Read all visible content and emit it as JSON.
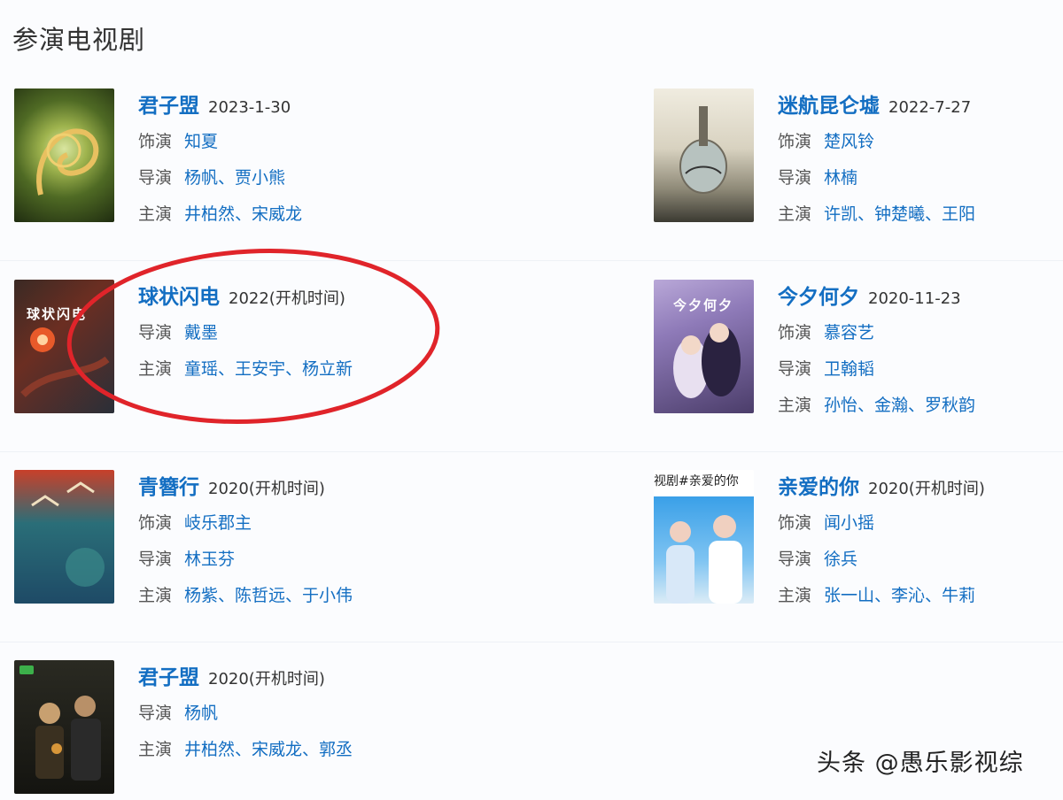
{
  "section": {
    "title": "参演电视剧"
  },
  "labels": {
    "role": "饰演",
    "director": "导演",
    "cast": "主演"
  },
  "works": [
    {
      "title": "君子盟",
      "date": "2023-1-30",
      "role": "知夏",
      "director": "杨帆、贾小熊",
      "cast": "井柏然、宋威龙"
    },
    {
      "title": "迷航昆仑墟",
      "date": "2022-7-27",
      "role": "楚风铃",
      "director": "林楠",
      "cast": "许凯、钟楚曦、王阳"
    },
    {
      "title": "球状闪电",
      "date": "2022(开机时间)",
      "director": "戴墨",
      "cast": "童瑶、王安宇、杨立新",
      "poster_text": "球状闪电"
    },
    {
      "title": "今夕何夕",
      "date": "2020-11-23",
      "role": "慕容艺",
      "director": "卫翰韬",
      "cast": "孙怡、金瀚、罗秋韵",
      "poster_text": "今夕何夕"
    },
    {
      "title": "青簪行",
      "date": "2020(开机时间)",
      "role": "岐乐郡主",
      "director": "林玉芬",
      "cast": "杨紫、陈哲远、于小伟"
    },
    {
      "title": "亲爱的你",
      "date": "2020(开机时间)",
      "role": "闻小摇",
      "director": "徐兵",
      "cast": "张一山、李沁、牛莉",
      "poster_caption": "视剧#亲爱的你"
    },
    {
      "title": "君子盟",
      "date": "2020(开机时间)",
      "director": "杨帆",
      "cast": "井柏然、宋威龙、郭丞"
    }
  ],
  "watermark": "头条 @愚乐影视综",
  "colors": {
    "link": "#136ec2",
    "highlight_ring": "#e0242a"
  }
}
